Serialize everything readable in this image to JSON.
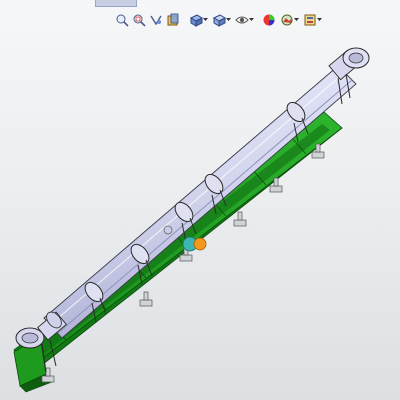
{
  "window": {
    "title": "",
    "background_top": "#f6f7f8",
    "background_bottom": "#dde0e3"
  },
  "heads_up_toolbar": {
    "items": [
      {
        "name": "zoom-to-fit-icon",
        "has_dropdown": false
      },
      {
        "name": "zoom-to-area-icon",
        "has_dropdown": false
      },
      {
        "name": "previous-view-icon",
        "has_dropdown": false
      },
      {
        "name": "section-view-icon",
        "has_dropdown": false
      },
      {
        "name": "view-orientation-icon",
        "has_dropdown": true
      },
      {
        "name": "display-style-icon",
        "has_dropdown": true
      },
      {
        "name": "hide-show-items-icon",
        "has_dropdown": true
      },
      {
        "name": "edit-appearance-icon",
        "has_dropdown": false
      },
      {
        "name": "apply-scene-icon",
        "has_dropdown": true
      },
      {
        "name": "view-settings-icon",
        "has_dropdown": true
      }
    ]
  },
  "model": {
    "description_colors": {
      "frame": "#1e9a1e",
      "frame_dark": "#0f6e12",
      "tube": "#d9daf0",
      "tube_shade": "#b5b7d8",
      "outline": "#2b2b2b",
      "marker_teal": "#3bb6b0",
      "marker_orange": "#f39a1e"
    },
    "support_count": 6,
    "clamp_count": 5
  }
}
